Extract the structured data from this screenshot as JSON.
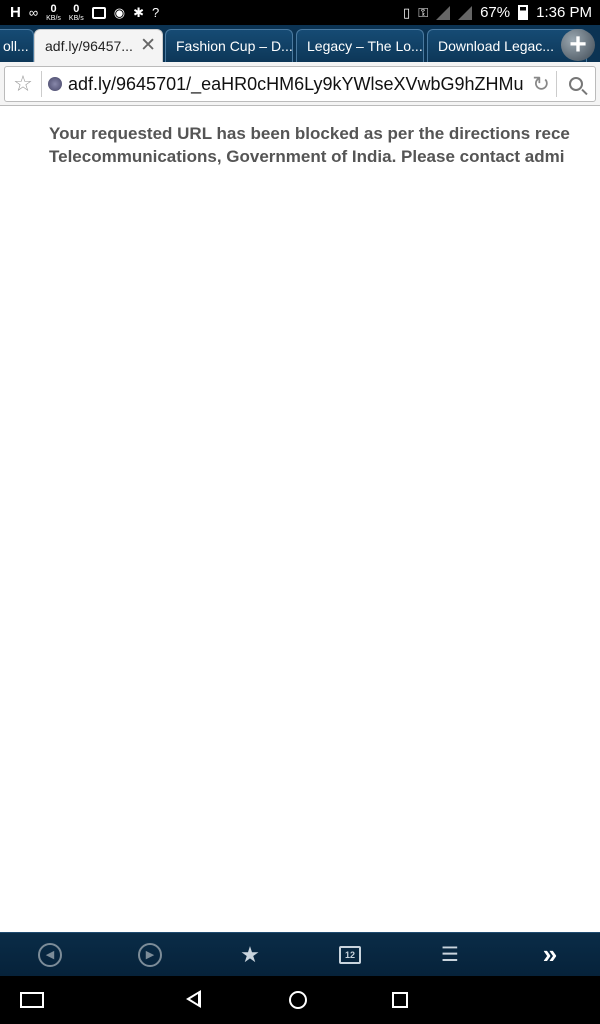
{
  "status_bar": {
    "network": "H",
    "speed_down": "0",
    "speed_up": "0",
    "speed_unit": "KB/s",
    "battery": "67%",
    "time": "1:36 PM"
  },
  "tabs": [
    {
      "label": "oll..."
    },
    {
      "label": "adf.ly/96457...",
      "active": true
    },
    {
      "label": "Fashion Cup – D..."
    },
    {
      "label": "Legacy – The Lo..."
    },
    {
      "label": "Download Legac..."
    }
  ],
  "address_bar": {
    "url": "adf.ly/9645701/_eaHR0cHM6Ly9kYWlseXVwbG9hZHMu"
  },
  "content": {
    "line1": "Your requested URL has been blocked as per the directions rece",
    "line2": "Telecommunications, Government of India. Please contact admi"
  },
  "toolbar": {
    "tab_count": "12"
  }
}
